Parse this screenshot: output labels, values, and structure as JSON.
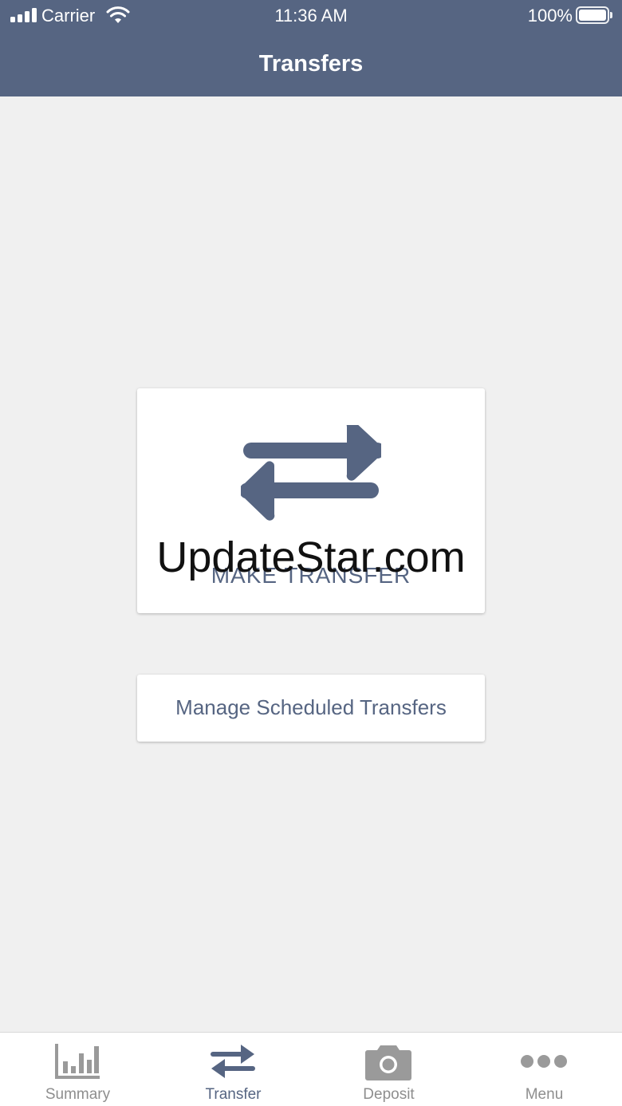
{
  "status_bar": {
    "carrier": "Carrier",
    "time": "11:36 AM",
    "battery": "100%"
  },
  "header": {
    "title": "Transfers"
  },
  "main": {
    "make_transfer_label": "MAKE TRANSFER",
    "make_transfer_icon": "transfer-arrows-icon",
    "manage_label": "Manage Scheduled Transfers"
  },
  "watermark": "UpdateStar.com",
  "tabbar": {
    "active": "Transfer",
    "items": [
      {
        "label": "Summary",
        "icon": "bar-chart-icon"
      },
      {
        "label": "Transfer",
        "icon": "transfer-arrows-icon"
      },
      {
        "label": "Deposit",
        "icon": "camera-icon"
      },
      {
        "label": "Menu",
        "icon": "more-dots-icon"
      }
    ]
  },
  "colors": {
    "accent": "#566582",
    "background": "#f0f0f0",
    "inactive_tab": "#8e8e8e"
  }
}
